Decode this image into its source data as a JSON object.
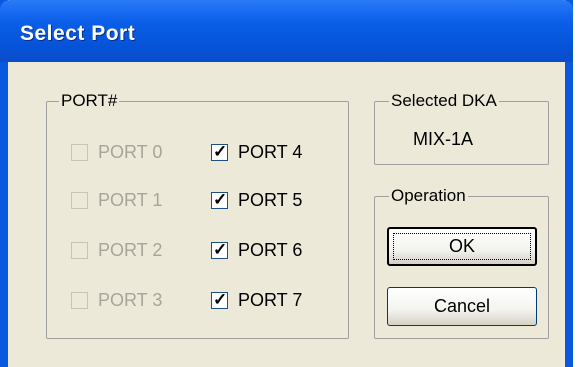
{
  "window": {
    "title": "Select Port"
  },
  "port_group": {
    "legend": "PORT#",
    "ports": [
      {
        "label": "PORT 0",
        "checked": false,
        "enabled": false
      },
      {
        "label": "PORT 1",
        "checked": false,
        "enabled": false
      },
      {
        "label": "PORT 2",
        "checked": false,
        "enabled": false
      },
      {
        "label": "PORT 3",
        "checked": false,
        "enabled": false
      },
      {
        "label": "PORT 4",
        "checked": true,
        "enabled": true
      },
      {
        "label": "PORT 5",
        "checked": true,
        "enabled": true
      },
      {
        "label": "PORT 6",
        "checked": true,
        "enabled": true
      },
      {
        "label": "PORT 7",
        "checked": true,
        "enabled": true
      }
    ]
  },
  "selected_dka": {
    "legend": "Selected DKA",
    "value": "MIX-1A"
  },
  "operation": {
    "legend": "Operation",
    "ok_label": "OK",
    "cancel_label": "Cancel"
  },
  "colors": {
    "titlebar": "#0653d8",
    "dialog_bg": "#ece9d8",
    "disabled_text": "#a7a59a"
  }
}
